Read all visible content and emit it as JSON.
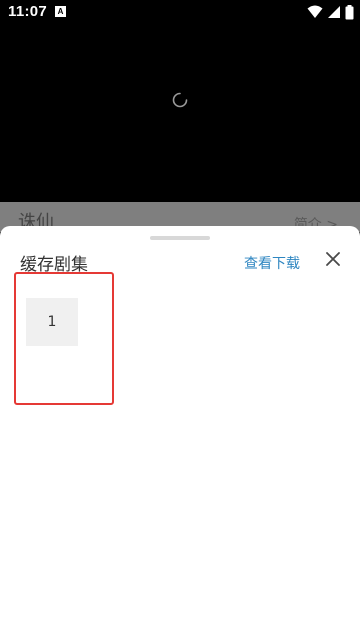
{
  "status_bar": {
    "time": "11:07",
    "notification_badge": "A"
  },
  "video": {
    "loading": true
  },
  "detail": {
    "title": "诛仙",
    "intro_link": "简介 >"
  },
  "sheet": {
    "title": "缓存剧集",
    "view_downloads": "查看下载",
    "close_icon": "close-icon",
    "episodes": [
      "1"
    ]
  },
  "colors": {
    "accent": "#2e86c1",
    "highlight": "#e53935"
  }
}
